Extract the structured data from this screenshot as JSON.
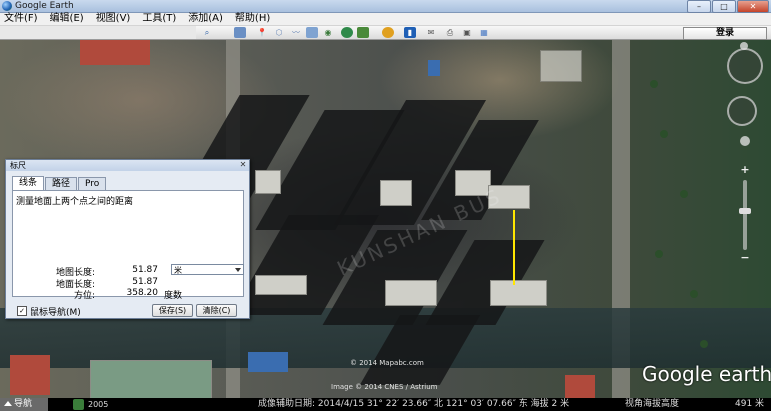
{
  "window": {
    "title": "Google Earth",
    "controls": {
      "minimize": "–",
      "maximize": "□",
      "close": "✕"
    }
  },
  "menubar": {
    "items": [
      "文件(F)",
      "编辑(E)",
      "视图(V)",
      "工具(T)",
      "添加(A)",
      "帮助(H)"
    ]
  },
  "toolbar": {
    "login_label": "登录",
    "icons": [
      "search-icon",
      "sidebar-toggle-icon",
      "placemark-icon",
      "polygon-icon",
      "path-icon",
      "image-overlay-icon",
      "tour-icon",
      "historical-imagery-icon",
      "sunlight-icon",
      "planets-icon",
      "ruler-icon",
      "email-icon",
      "print-icon",
      "save-image-icon",
      "maps-icon"
    ]
  },
  "map": {
    "watermark": "KUNSHAN BUS",
    "copyright_1": "© 2014 Mapabc.com",
    "copyright_2": "Image © 2014 CNES / Astrium",
    "logo": "Google earth"
  },
  "navigation": {
    "zoom_in": "+",
    "zoom_out": "−"
  },
  "ruler_dialog": {
    "title": "标尺",
    "close_label": "✕",
    "tabs": [
      "线条",
      "路径",
      "Pro"
    ],
    "description": "测量地面上两个点之间的距离",
    "map_length_label": "地图长度:",
    "map_length_value": "51.87",
    "unit_selected": "米",
    "ground_length_label": "地面长度:",
    "ground_length_value": "51.87",
    "heading_label": "方位:",
    "heading_value": "358.20",
    "heading_unit": "度数",
    "mouse_nav_label": "鼠标导航(M)",
    "mouse_nav_checked": "✓",
    "save_label": "保存(S)",
    "clear_label": "清除(C)"
  },
  "statusbar": {
    "nav_tab": "导航",
    "imagery_year": "2005",
    "info": "成像辅助日期: 2014/4/15   31° 22′ 23.66″ 北 121° 03′ 07.66″ 东 海拔   2 米",
    "eye_alt_label": "视角海拔高度",
    "eye_alt_value": "491 米"
  }
}
